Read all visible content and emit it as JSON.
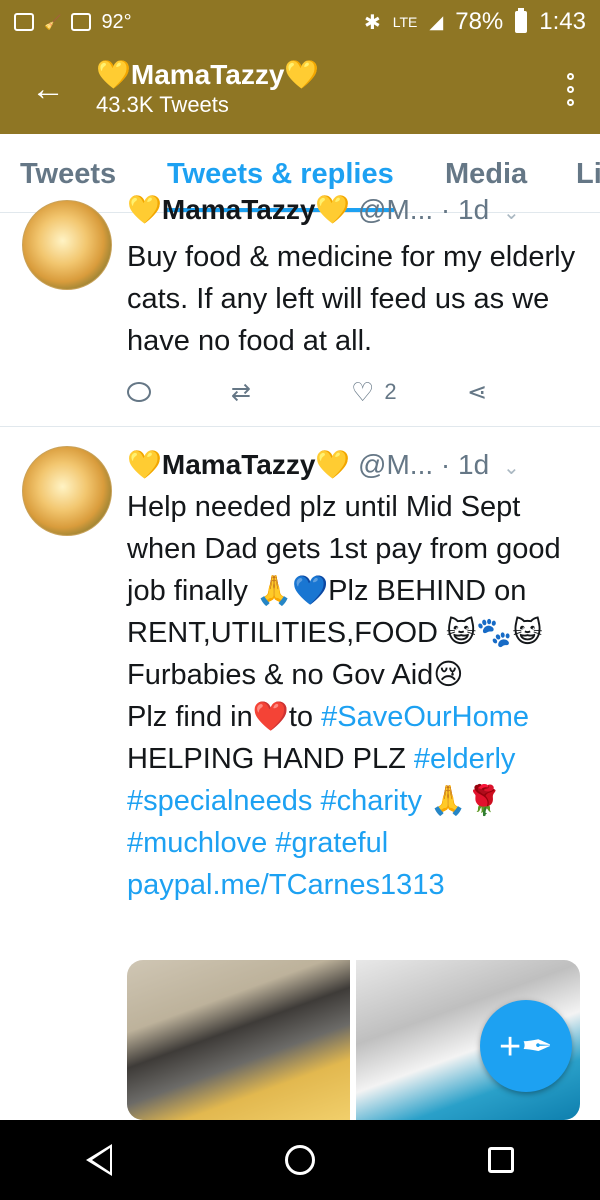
{
  "status_bar": {
    "temperature": "92°",
    "network": "LTE",
    "battery": "78%",
    "time": "1:43"
  },
  "header": {
    "back_icon": "arrow-left-icon",
    "title": "💛MamaTazzy💛",
    "subtitle": "43.3K Tweets",
    "menu_icon": "more-vertical-icon"
  },
  "tabs": [
    {
      "label": "Tweets"
    },
    {
      "label": "Tweets & replies"
    },
    {
      "label": "Media"
    },
    {
      "label": "Li"
    }
  ],
  "tweets": [
    {
      "name": "💛MamaTazzy💛",
      "handle": "@M...",
      "time": "· 1d",
      "text": "Buy food & medicine for my elderly cats. If any left will feed us as we have no food at all.",
      "likes": "2"
    },
    {
      "name": "💛MamaTazzy💛",
      "handle": "@M...",
      "time": "· 1d",
      "text_1": "Help needed plz until Mid Sept when Dad gets 1st pay from good job finally 🙏💙Plz BEHIND on RENT,UTILITIES,FOOD 😺🐾😺 Furbabies & no Gov Aid😢",
      "text_2": "Plz find in❤️to ",
      "hashtag_1": "#SaveOurHome",
      "text_3": "HELPING HAND PLZ ",
      "hashtag_2": "#elderly",
      "hashtag_3": "#specialneeds",
      "hashtag_4": "#charity",
      "text_4": " 🙏🌹",
      "hashtag_5": "#muchlove",
      "hashtag_6": "#grateful",
      "link": "paypal.me/TCarnes1313"
    }
  ],
  "fab": {
    "icon": "compose-tweet-icon",
    "symbol": "+✒"
  },
  "colors": {
    "brand": "#8f7624",
    "accent": "#1da1f2"
  }
}
